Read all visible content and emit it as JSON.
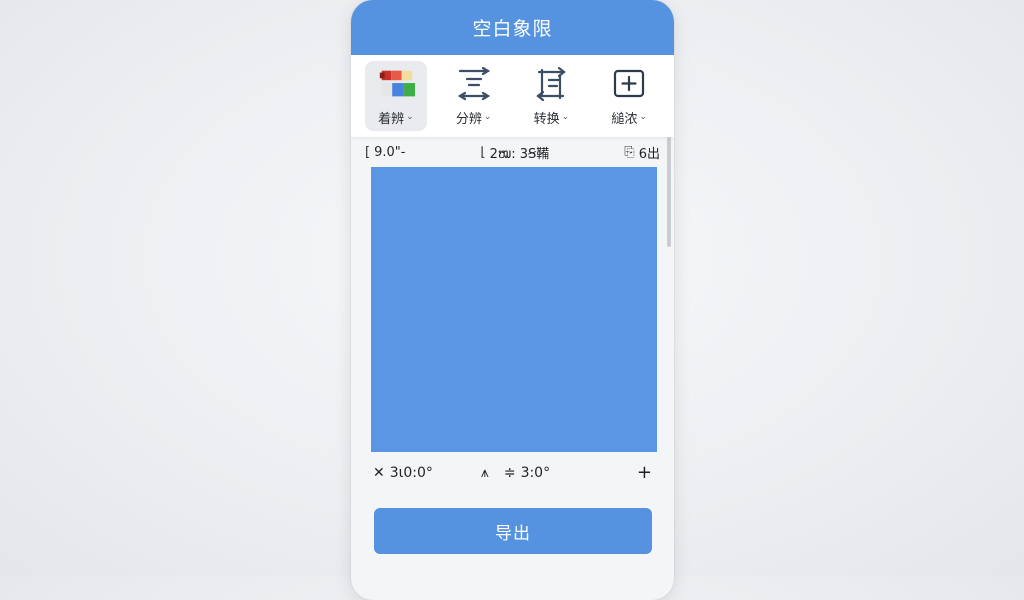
{
  "app": {
    "title": "空白象限"
  },
  "toolbar": {
    "items": [
      {
        "label": "着辨",
        "icon": "color-palette-icon",
        "active": true
      },
      {
        "label": "分辨",
        "icon": "align-lines-icon",
        "active": false
      },
      {
        "label": "转换",
        "icon": "swap-arrows-icon",
        "active": false
      },
      {
        "label": "縋浓",
        "icon": "add-square-icon",
        "active": false
      }
    ]
  },
  "stats": {
    "left": "9.0\"-",
    "middle": "2ໝ: 3Ꞩ鞴",
    "right": "6出"
  },
  "bottom": {
    "rotation": "3ι0:0°",
    "angle": "3:0°",
    "add": "+"
  },
  "export": {
    "label": "导出"
  },
  "colors": {
    "accent": "#5592e0",
    "canvas": "#5b96e5",
    "palette": [
      "#d9432f",
      "#f0c850",
      "#4a82df",
      "#3fae49",
      "#e8e0c8"
    ]
  }
}
